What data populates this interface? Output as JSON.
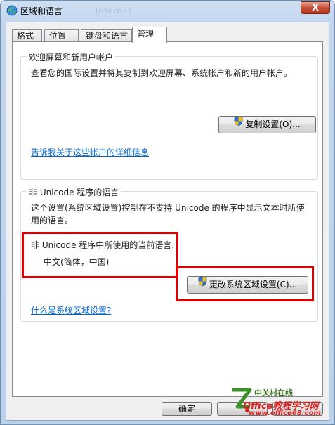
{
  "window": {
    "title": "区域和语言",
    "title_ghost_text": "Internet",
    "close_label": "X"
  },
  "tabs": [
    {
      "label": "格式",
      "active": false
    },
    {
      "label": "位置",
      "active": false
    },
    {
      "label": "键盘和语言",
      "active": false
    },
    {
      "label": "管理",
      "active": true
    }
  ],
  "welcome_group": {
    "title": "欢迎屏幕和新用户帐户",
    "description": "查看您的国际设置并将其复制到欢迎屏幕、系统帐户和新的用户帐户。",
    "copy_button": "复制设置(O)...",
    "link": "告诉我关于这些帐户的详细信息"
  },
  "unicode_group": {
    "title": "非 Unicode 程序的语言",
    "description": "这个设置(系统区域设置)控制在不支持 Unicode 的程序中显示文本时所使用的语言。",
    "current_label": "非 Unicode 程序中所使用的当前语言:",
    "current_value": "中文(简体，中国)",
    "change_button": "更改系统区域设置(C)...",
    "link": "什么是系统区域设置?"
  },
  "footer": {
    "ok_button": "确定"
  },
  "watermark": {
    "cn_text": "中关村在线",
    "brand": "Office教程学习网",
    "url": "www.office68.com"
  },
  "colors": {
    "highlight_box": "#e00000",
    "link": "#0066cc",
    "title_bar": "#c3d6ee"
  },
  "icons": [
    "globe-icon",
    "shield-icon"
  ]
}
